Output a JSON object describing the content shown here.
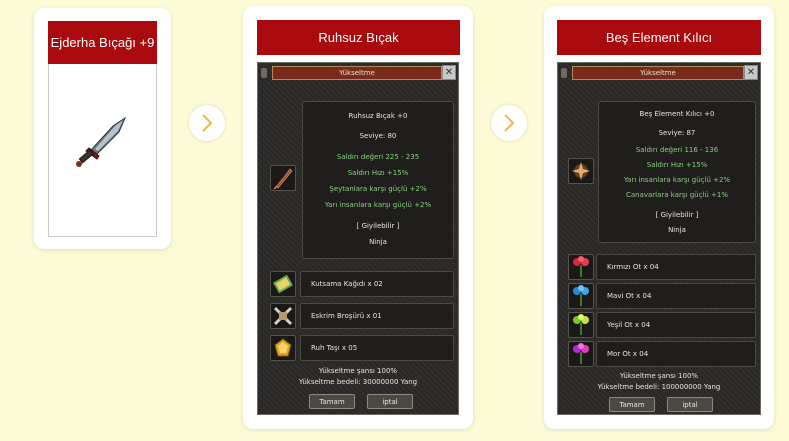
{
  "cards": [
    {
      "title": "Ejderha Bıçağı +9"
    },
    {
      "title": "Ruhsuz Bıçak",
      "window_title": "Yükseltme",
      "item_lines": [
        {
          "text": "Ruhsuz Bıçak +0",
          "color": "#eae6dc"
        },
        {
          "text": "Seviye: 80",
          "color": "#eae6dc"
        },
        {
          "text": "Saldırı değeri 225 - 235",
          "color": "#8ccf7f"
        },
        {
          "text": "Saldırı Hızı +15%",
          "color": "#8ccf7f"
        },
        {
          "text": "Şeytanlara karşı güçlü +2%",
          "color": "#8ccf7f"
        },
        {
          "text": "Yarı insanlara karşı güçlü +2%",
          "color": "#8ccf7f"
        },
        {
          "text": "[ Giyilebilir ]",
          "color": "#eae6dc"
        },
        {
          "text": "Ninja",
          "color": "#eae6dc"
        }
      ],
      "materials": [
        "Kutsama Kağıdı x 02",
        "Eskrim Broşürü x 01",
        "Ruh Taşı x 05"
      ],
      "chance": "Yükseltme şansı 100%",
      "cost": "Yükseltme bedeli: 30000000 Yang",
      "ok": "Tamam",
      "cancel": "iptal"
    },
    {
      "title": "Beş Element Kılıcı",
      "window_title": "Yükseltme",
      "item_lines": [
        {
          "text": "Beş Element Kılıcı +0",
          "color": "#eae6dc"
        },
        {
          "text": "Seviye: 87",
          "color": "#eae6dc"
        },
        {
          "text": "Saldırı değeri 116 - 136",
          "color": "#8ccf7f"
        },
        {
          "text": "Saldırı Hızı +15%",
          "color": "#8ccf7f"
        },
        {
          "text": "Yarı insanlara karşı güçlü +2%",
          "color": "#8ccf7f"
        },
        {
          "text": "Canavarlara karşı güçlü +1%",
          "color": "#8ccf7f"
        },
        {
          "text": "[ Giyilebilir ]",
          "color": "#eae6dc"
        },
        {
          "text": "Ninja",
          "color": "#eae6dc"
        }
      ],
      "materials": [
        "Kırmızı Ot x 04",
        "Mavi Ot x 04",
        "Yeşil Ot x 04",
        "Mor Ot x 04"
      ],
      "chance": "Yükseltme şansı 100%",
      "cost": "Yükseltme bedeli: 100000000 Yang",
      "ok": "Tamam",
      "cancel": "iptal"
    }
  ]
}
